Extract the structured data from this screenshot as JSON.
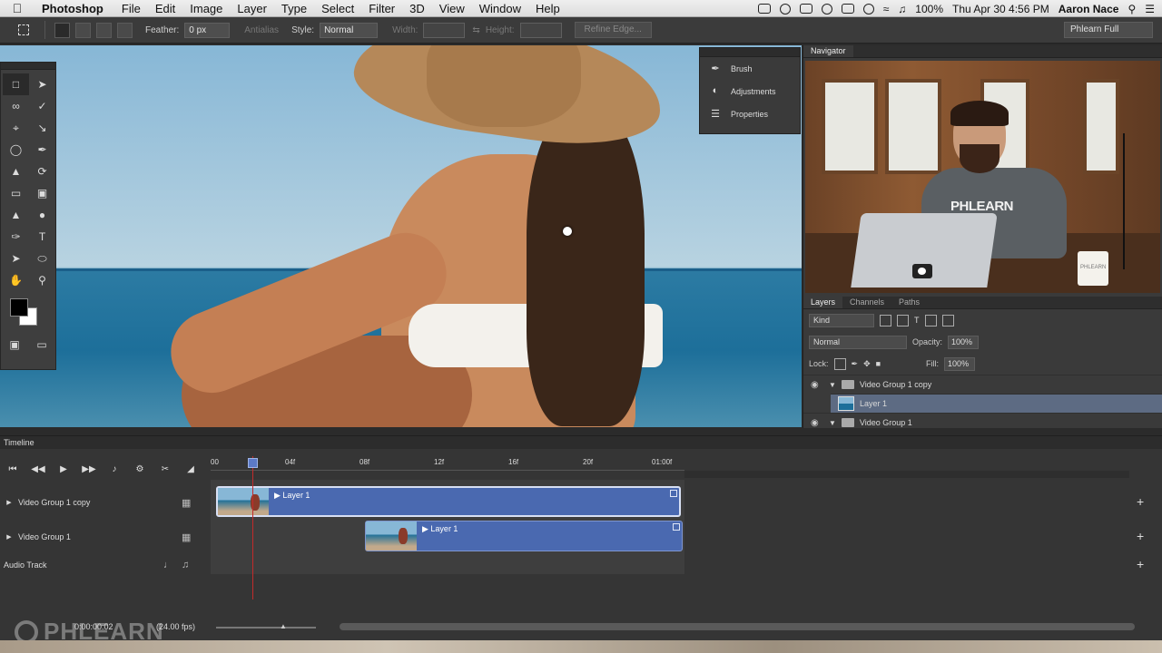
{
  "menubar": {
    "app": "Photoshop",
    "items": [
      "File",
      "Edit",
      "Image",
      "Layer",
      "Type",
      "Select",
      "Filter",
      "3D",
      "View",
      "Window",
      "Help"
    ],
    "battery": "100%",
    "datetime": "Thu Apr 30  4:56 PM",
    "user": "Aaron Nace"
  },
  "options": {
    "feather_label": "Feather:",
    "feather_value": "0 px",
    "antialias": "Antialias",
    "style_label": "Style:",
    "style_value": "Normal",
    "width_label": "Width:",
    "height_label": "Height:",
    "refine_edge": "Refine Edge...",
    "workspace": "Phlearn Full"
  },
  "dock": {
    "items": [
      {
        "label": "Brush",
        "icon": "brush-icon"
      },
      {
        "label": "Adjustments",
        "icon": "adjustments-icon"
      },
      {
        "label": "Properties",
        "icon": "properties-icon"
      }
    ]
  },
  "navigator": {
    "tab": "Navigator",
    "overlay_brand": "PHLEARN",
    "mug_text": "PHLEARN"
  },
  "layers": {
    "tabs": [
      "Layers",
      "Channels",
      "Paths"
    ],
    "filter": "Kind",
    "blend_mode": "Normal",
    "opacity_label": "Opacity:",
    "opacity_value": "100%",
    "lock_label": "Lock:",
    "fill_label": "Fill:",
    "fill_value": "100%",
    "rows": [
      {
        "name": "Video Group 1 copy",
        "type": "group"
      },
      {
        "name": "Layer 1",
        "type": "layer"
      },
      {
        "name": "Video Group 1",
        "type": "group"
      }
    ]
  },
  "timeline": {
    "title": "Timeline",
    "ruler": [
      "00",
      "04f",
      "08f",
      "12f",
      "16f",
      "20f",
      "01:00f"
    ],
    "tracks": [
      {
        "name": "Video Group 1 copy",
        "clip": "Layer 1"
      },
      {
        "name": "Video Group 1",
        "clip": "Layer 1"
      },
      {
        "name": "Audio Track"
      }
    ],
    "timecode": "0:00:00:02",
    "fps": "(24.00 fps)"
  },
  "watermark": "PHLEARN",
  "colors": {
    "panel_bg": "#3a3a3a",
    "clip_blue": "#4a69b0",
    "playhead": "#c32b2b",
    "selected_layer": "#5d6b83"
  }
}
